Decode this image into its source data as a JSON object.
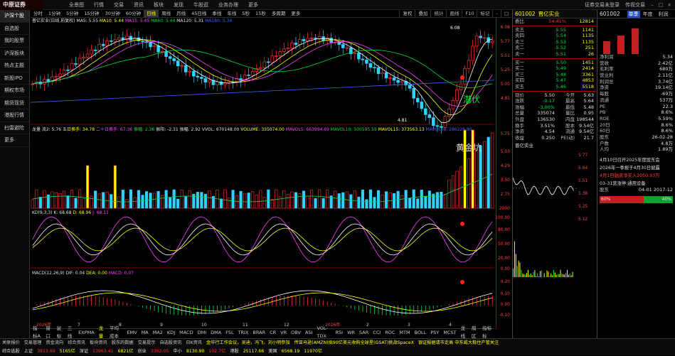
{
  "app": {
    "logo": "中原证券",
    "menu": [
      "全景图",
      "行情",
      "交易",
      "资讯",
      "板块",
      "发现",
      "牛股逛",
      "业务办理",
      "更多"
    ],
    "topright": [
      "证券交易未登录",
      "传视交易"
    ]
  },
  "sidebar": [
    "沪深个股",
    "自选股",
    "我的股票",
    "沪深板块",
    "热点主题",
    "新股IPO",
    "期权市场",
    "期货现货",
    "港股行情",
    "扫雷避险",
    "更多"
  ],
  "toolbar": {
    "periods": [
      "分时",
      "1分钟",
      "5分钟",
      "15分钟",
      "30分钟",
      "60分钟",
      "日线",
      "周线",
      "月线",
      "45日线",
      "季线",
      "年线",
      "5秒",
      "15秒",
      "多周期",
      "更多"
    ],
    "active": 6,
    "right": [
      "复权",
      "叠加",
      "统计",
      "画线",
      "F10",
      "标记",
      "-",
      "□"
    ]
  },
  "chart_title": "普亿实业(日线,前复权)",
  "ma": {
    "ma5": "MA5: 5.55",
    "ma10": "MA10: 5.44",
    "ma15": "MA15: 5.45",
    "ma60": "MA60: 5.44",
    "ma120": "MA120: 5.31",
    "ma180": "MA180: 5.34"
  },
  "annotations": {
    "high": "6.08",
    "low": "4.81",
    "tag1": "潜伏",
    "tag2": "黄金坑"
  },
  "volume_legend": {
    "a": "龙量 流2: 5.76",
    "b": "五日换手: 34.78",
    "c": "二十日换手: 67.36",
    "d": "振幅: 2.36",
    "e": "振阳: -2.31",
    "f": "振幅: 2.92",
    "g": "VVOL: 670148.00",
    "h": "VOLUME: 335074.00",
    "i": "MAVOL5: 663994.69",
    "j": "MAVOL10: 500595.59",
    "k": "MAVOL15: 373563.13",
    "l": "MAVOL30: 286226.80"
  },
  "kdj_legend": {
    "name": "KD(9,3,3)",
    "k": "K: 68.68",
    "d": "D: 68.96",
    "j": "J: 68.11"
  },
  "macd_legend": {
    "name": "MACD(12,26,9)",
    "dif": "DIF: 0.04",
    "dea": "DEA: 0.00",
    "macd": "MACD: 0.07"
  },
  "axis": {
    "price": [
      "6.08",
      "5.77",
      "5.51",
      "5.25",
      "5.05",
      "4.81"
    ],
    "vol": [
      "5.75",
      "5.03",
      "4.29",
      "3.50",
      "2.75",
      "2000"
    ],
    "kdj": [
      "100.00",
      "80.00",
      "50.00",
      "20.00",
      "0.00"
    ],
    "macd": [
      "0.20",
      "0.10",
      "0.00",
      "-0.10"
    ]
  },
  "xlabels": [
    "2026年",
    "7",
    "8",
    "9",
    "10",
    "11",
    "12",
    "2026年",
    "2",
    "3",
    "4"
  ],
  "bottomtabs": [
    "指标A",
    "窗口",
    "鼠标",
    "三线",
    "EXPMA",
    "龙量",
    "平均成本",
    "EMV",
    "MA",
    "MA2",
    "KDJ",
    "MACD",
    "DMI",
    "DMA",
    "FSL",
    "TRIX",
    "BRAR",
    "CR",
    "VR",
    "OBV",
    "ASI",
    "VOL-TDX",
    "RSI",
    "WR",
    "SAR",
    "CCI",
    "ROC",
    "MTM",
    "BOLL",
    "PSY",
    "MCST",
    "龙线",
    "扇区",
    "指标标"
  ],
  "quote": {
    "code": "601002",
    "name": "晋亿实业",
    "weibi": "54.41%",
    "weicha": "12814",
    "sell": [
      [
        "卖五",
        "5.55",
        "1141"
      ],
      [
        "卖四",
        "5.54",
        "1135"
      ],
      [
        "卖三",
        "5.53",
        "1135"
      ],
      [
        "卖二",
        "5.52",
        "251"
      ],
      [
        "卖一",
        "5.51",
        "26"
      ]
    ],
    "buy": [
      [
        "买一",
        "5.50",
        "1451"
      ],
      [
        "买二",
        "5.49",
        "2414"
      ],
      [
        "买三",
        "5.48",
        "3361"
      ],
      [
        "买四",
        "5.47",
        "4853"
      ],
      [
        "买五",
        "5.46",
        "5518"
      ]
    ],
    "stats": [
      [
        "现价",
        "5.50",
        "今开",
        "5.63"
      ],
      [
        "涨跌",
        "-0.17",
        "最高",
        "5.64"
      ],
      [
        "涨幅",
        "-3.00%",
        "最低",
        "5.48"
      ],
      [
        "总量",
        "335074",
        "量比",
        "0.95"
      ],
      [
        "外盘",
        "136530",
        "内盘",
        "198544"
      ],
      [
        "换手",
        "3.51%",
        "股本",
        "9.54亿"
      ],
      [
        "净资",
        "4.54",
        "流通",
        "9.54亿"
      ],
      [
        "收益",
        "0.250",
        "PE(动)",
        "21.7"
      ]
    ],
    "sub": "晋亿实业",
    "ticks": [
      "5.77",
      "5.64",
      "5.51",
      "5.38",
      "5.25",
      "5.12"
    ]
  },
  "f10": {
    "code": "601002",
    "tabs": [
      "单季",
      "年度",
      "利润"
    ],
    "rows": [
      [
        "净利润",
        "5.34"
      ],
      [
        "营收",
        "2.42亿"
      ],
      [
        "毛利率",
        "680万"
      ],
      [
        "营业利",
        "2.11亿"
      ],
      [
        "利润总",
        "3.74亿"
      ],
      [
        "净资",
        "19.14亿"
      ],
      [
        "每股",
        "-69万"
      ],
      [
        "流通",
        "537万"
      ],
      [
        "PE",
        "22.3"
      ],
      [
        "PB",
        "8.6%"
      ],
      [
        "ROE",
        "5.59%"
      ],
      [
        "20日",
        "8.6%"
      ],
      [
        "60日",
        "8.6%"
      ],
      [
        "股东",
        "26-02-28"
      ],
      [
        "户数",
        "4.8万"
      ],
      [
        "人均",
        "1.89万"
      ]
    ],
    "news": [
      "4月10日召开2025年度股东会",
      "2026年一季报于4月30日披露",
      "4月1日融资净买入2050.93万",
      "03-31营涨停:通用设备"
    ],
    "shares": {
      "label": "股东",
      "date": "04-01",
      "value": "2017-12"
    },
    "bars": {
      "red": "60%",
      "green": "40%"
    }
  },
  "statusbar": {
    "row1": [
      "关联报价",
      "交易管理",
      "资金流向",
      "综合资讯",
      "板块资讯",
      "股东的数据",
      "交易提示",
      "自选股资讯",
      "日K资讯",
      "金华行工作会议，吴迪，冯飞，刘小明参加",
      "传亚马逊(AMZN)拟90亿美元收购全球星(GSAT)挑战SpaceX",
      "银证报据请市走高 中东威大稳住产管关注"
    ],
    "row2": [
      "上证",
      "3913.69",
      "5165亿",
      "深证",
      "13963.41",
      "6821亿",
      "创业",
      "3362.05",
      "中小",
      "8130.90",
      "102.7亿",
      "港股",
      "25117.66",
      "美国",
      "6568.19",
      "11970亿"
    ],
    "footer": "综合选股"
  }
}
